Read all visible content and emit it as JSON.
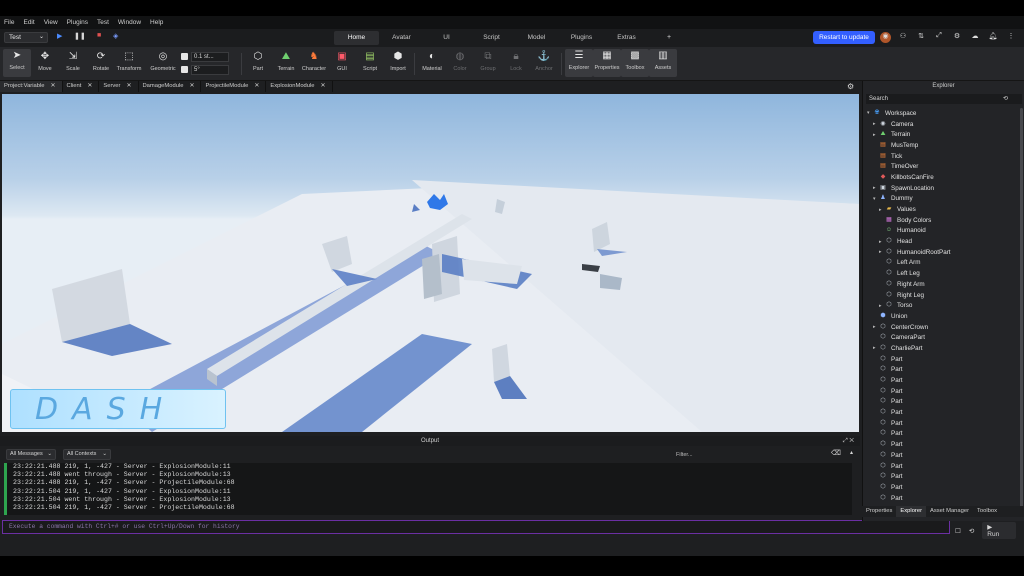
{
  "menubar": {
    "items": [
      "File",
      "Edit",
      "View",
      "Plugins",
      "Test",
      "Window",
      "Help"
    ]
  },
  "topbar": {
    "place": "Test",
    "tabs": [
      "Home",
      "Avatar",
      "UI",
      "Script",
      "Model",
      "Plugins",
      "Extras"
    ],
    "active_tab": "Home",
    "more": "+",
    "restart_label": "Restart to update"
  },
  "ribbon": {
    "tools": [
      {
        "label": "Select",
        "icon": "cursor-icon"
      },
      {
        "label": "Move",
        "icon": "move-icon"
      },
      {
        "label": "Scale",
        "icon": "scale-icon"
      },
      {
        "label": "Rotate",
        "icon": "rotate-icon"
      },
      {
        "label": "Transform",
        "icon": "transform-icon"
      },
      {
        "label": "Geometric",
        "icon": "geometric-icon"
      }
    ],
    "snap_move": "0.1 st...",
    "snap_rotate": "5°",
    "insert": [
      "Part",
      "Terrain",
      "Character",
      "GUI",
      "Script",
      "Import"
    ],
    "edit": [
      "Material",
      "Color",
      "Group",
      "Lock",
      "Anchor"
    ],
    "windows": [
      "Explorer",
      "Properties",
      "Toolbox",
      "Assets"
    ]
  },
  "doc_tabs": [
    "Project:Variable",
    "Client",
    "Server",
    "DamageModule",
    "ProjectileModule",
    "ExplosionModule"
  ],
  "viewport": {
    "overlay_text": "DASH"
  },
  "output": {
    "title": "Output",
    "filter_messages": "All Messages",
    "filter_contexts": "All Contexts",
    "filter_placeholder": "Filter...",
    "lines": [
      "23:22:21.488  219, 1, -427  -  Server - ExplosionModule:11",
      "23:22:21.488  went through  -  Server - ExplosionModule:13",
      "23:22:21.488  219, 1, -427  -  Server - ProjectileModule:68",
      "23:22:21.504  219, 1, -427  -  Server - ExplosionModule:11",
      "23:22:21.504  went through  -  Server - ExplosionModule:13",
      "23:22:21.504  219, 1, -427  -  Server - ProjectileModule:68"
    ]
  },
  "command_bar": {
    "placeholder": "Execute a command with Ctrl+# or use Ctrl+Up/Down for history",
    "run_label": "Run"
  },
  "explorer": {
    "title": "Explorer",
    "search_placeholder": "Search",
    "items": [
      {
        "label": "Workspace",
        "depth": 0,
        "arrow": "v",
        "icon": "globe"
      },
      {
        "label": "Camera",
        "depth": 1,
        "arrow": ">",
        "icon": "camera"
      },
      {
        "label": "Terrain",
        "depth": 1,
        "arrow": ">",
        "icon": "terrain"
      },
      {
        "label": "MusTemp",
        "depth": 1,
        "arrow": "",
        "icon": "script"
      },
      {
        "label": "Tick",
        "depth": 1,
        "arrow": "",
        "icon": "script"
      },
      {
        "label": "TimeOver",
        "depth": 1,
        "arrow": "",
        "icon": "script"
      },
      {
        "label": "KillbotsCanFire",
        "depth": 1,
        "arrow": "",
        "icon": "value"
      },
      {
        "label": "SpawnLocation",
        "depth": 1,
        "arrow": ">",
        "icon": "spawn"
      },
      {
        "label": "Dummy",
        "depth": 1,
        "arrow": "v",
        "icon": "model"
      },
      {
        "label": "Values",
        "depth": 2,
        "arrow": ">",
        "icon": "folder"
      },
      {
        "label": "Body Colors",
        "depth": 2,
        "arrow": "",
        "icon": "colors"
      },
      {
        "label": "Humanoid",
        "depth": 2,
        "arrow": "",
        "icon": "humanoid"
      },
      {
        "label": "Head",
        "depth": 2,
        "arrow": ">",
        "icon": "part"
      },
      {
        "label": "HumanoidRootPart",
        "depth": 2,
        "arrow": ">",
        "icon": "part"
      },
      {
        "label": "Left Arm",
        "depth": 2,
        "arrow": "",
        "icon": "part"
      },
      {
        "label": "Left Leg",
        "depth": 2,
        "arrow": "",
        "icon": "part"
      },
      {
        "label": "Right Arm",
        "depth": 2,
        "arrow": "",
        "icon": "part"
      },
      {
        "label": "Right Leg",
        "depth": 2,
        "arrow": "",
        "icon": "part"
      },
      {
        "label": "Torso",
        "depth": 2,
        "arrow": ">",
        "icon": "part"
      },
      {
        "label": "Union",
        "depth": 1,
        "arrow": "",
        "icon": "union"
      },
      {
        "label": "CenterCrown",
        "depth": 1,
        "arrow": ">",
        "icon": "part"
      },
      {
        "label": "CameraPart",
        "depth": 1,
        "arrow": "",
        "icon": "part"
      },
      {
        "label": "CharliePart",
        "depth": 1,
        "arrow": ">",
        "icon": "part"
      },
      {
        "label": "Part",
        "depth": 1,
        "arrow": "",
        "icon": "part"
      },
      {
        "label": "Part",
        "depth": 1,
        "arrow": "",
        "icon": "part"
      },
      {
        "label": "Part",
        "depth": 1,
        "arrow": "",
        "icon": "part"
      },
      {
        "label": "Part",
        "depth": 1,
        "arrow": "",
        "icon": "part"
      },
      {
        "label": "Part",
        "depth": 1,
        "arrow": "",
        "icon": "part"
      },
      {
        "label": "Part",
        "depth": 1,
        "arrow": "",
        "icon": "part"
      },
      {
        "label": "Part",
        "depth": 1,
        "arrow": "",
        "icon": "part"
      },
      {
        "label": "Part",
        "depth": 1,
        "arrow": "",
        "icon": "part"
      },
      {
        "label": "Part",
        "depth": 1,
        "arrow": "",
        "icon": "part"
      },
      {
        "label": "Part",
        "depth": 1,
        "arrow": "",
        "icon": "part"
      },
      {
        "label": "Part",
        "depth": 1,
        "arrow": "",
        "icon": "part"
      },
      {
        "label": "Part",
        "depth": 1,
        "arrow": "",
        "icon": "part"
      },
      {
        "label": "Part",
        "depth": 1,
        "arrow": "",
        "icon": "part"
      },
      {
        "label": "Part",
        "depth": 1,
        "arrow": "",
        "icon": "part"
      }
    ],
    "bottom_tabs": [
      "Properties",
      "Explorer",
      "Asset Manager",
      "Toolbox"
    ],
    "active_bottom_tab": "Explorer"
  },
  "colors": {
    "accent": "#335fff",
    "ok": "#2ea44f",
    "command_border": "#6b2fa3"
  }
}
